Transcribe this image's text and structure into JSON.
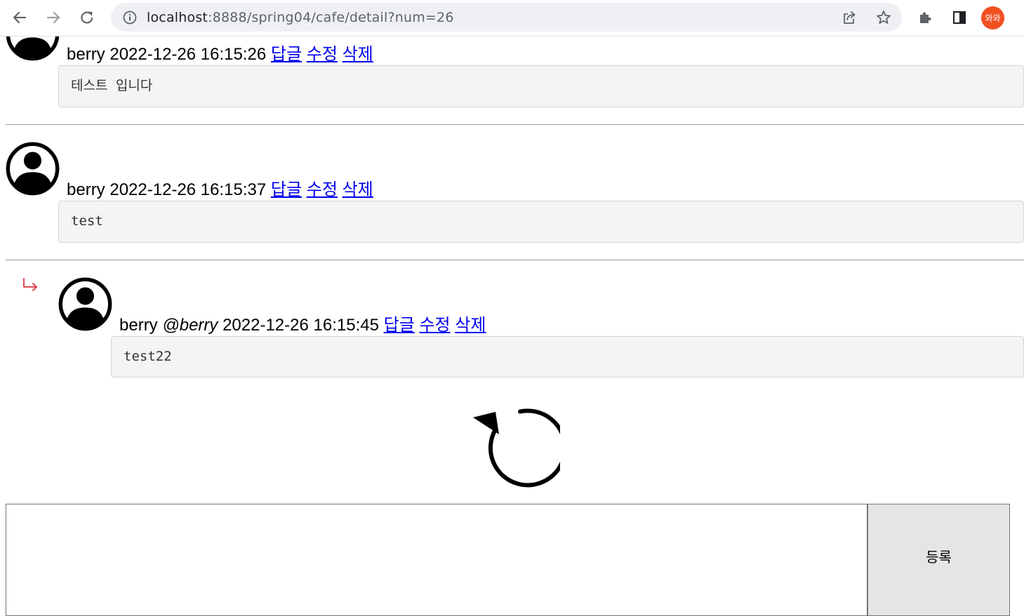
{
  "browser": {
    "url_host": "localhost",
    "url_rest": ":8888/spring04/cafe/detail?num=26",
    "profile_label": "와와"
  },
  "comments": [
    {
      "writer": "berry",
      "target": "",
      "date": "2022-12-26 16:15:26",
      "reply_label": "답글",
      "edit_label": "수정",
      "delete_label": "삭제",
      "content": "테스트 입니다"
    },
    {
      "writer": "berry",
      "target": "",
      "date": "2022-12-26 16:15:37",
      "reply_label": "답글",
      "edit_label": "수정",
      "delete_label": "삭제",
      "content": "test"
    },
    {
      "writer": "berry",
      "target": "@berry",
      "date": "2022-12-26 16:15:45",
      "reply_label": "답글",
      "edit_label": "수정",
      "delete_label": "삭제",
      "content": "test22"
    }
  ],
  "form": {
    "textarea_value": "",
    "submit_label": "등록"
  },
  "icons": {
    "reply_arrow": "reply-arrow-icon",
    "refresh": "refresh-icon",
    "avatar": "person-circle-icon"
  },
  "colors": {
    "link": "#0000ee",
    "reply_arrow": "#dc3545",
    "bubble_bg": "#f4f4f4",
    "profile_avatar": "#f25022"
  }
}
